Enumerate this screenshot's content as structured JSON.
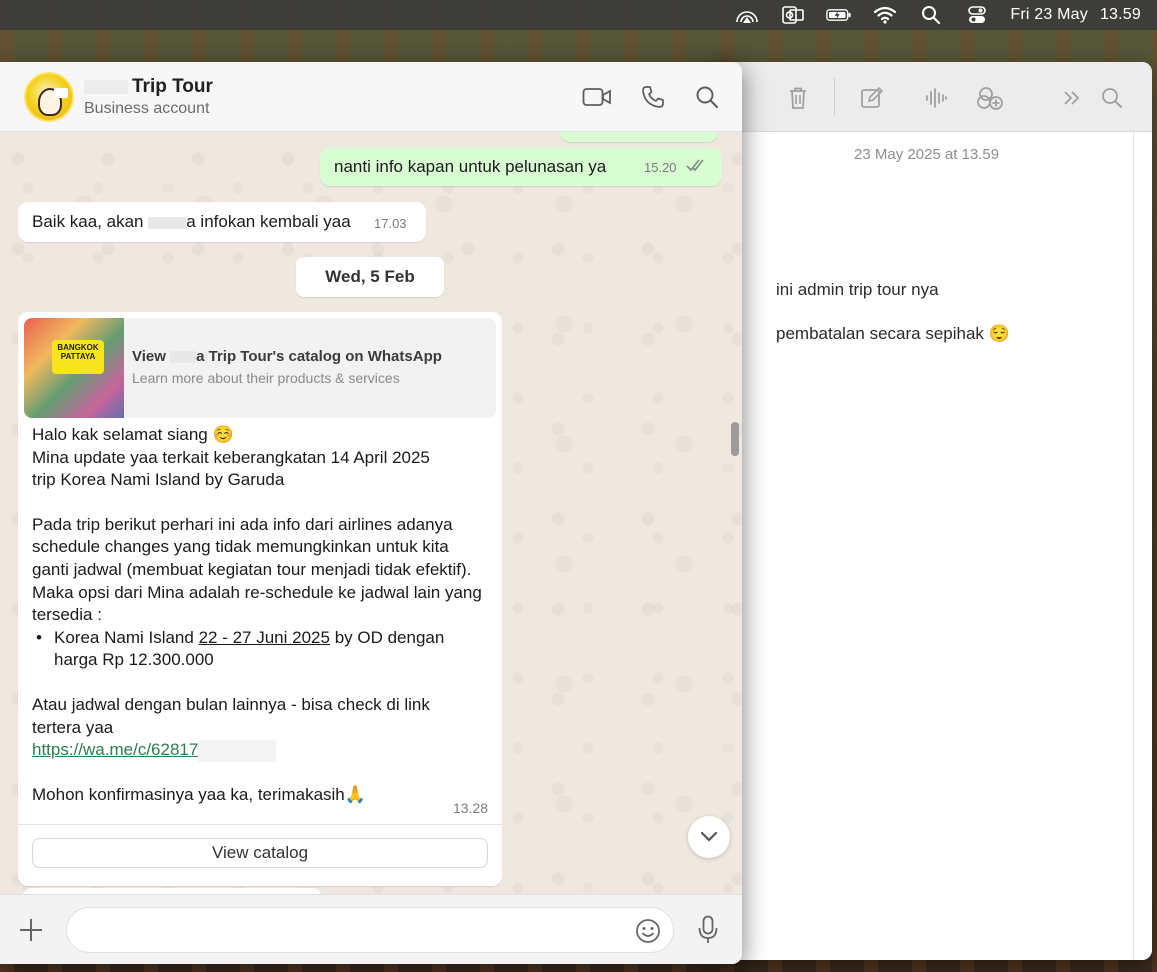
{
  "menubar": {
    "day": "Fri 23 May",
    "time": "13.59",
    "icons": [
      "airplay-icon",
      "outlook-icon",
      "battery-charging-icon",
      "wifi-icon",
      "spotlight-search-icon",
      "control-center-icon"
    ]
  },
  "notes": {
    "date": "23 May 2025 at 13.59",
    "line1": "ini admin trip tour nya",
    "line2": "pembatalan secara sepihak 😌",
    "toolbar_icons": [
      "trash-icon",
      "compose-icon",
      "audio-waveform-icon",
      "share-collab-icon",
      "chevron-double-right-icon",
      "search-icon"
    ]
  },
  "whatsapp": {
    "contact_name": "Trip Tour",
    "contact_subtitle": "Business account",
    "header_icons": [
      "video-call-icon",
      "voice-call-icon",
      "search-icon"
    ],
    "messages": {
      "out_1": {
        "text": "nanti info kapan untuk pelunasan ya",
        "time": "15.20"
      },
      "in_1": {
        "text_before": "Baik kaa, akan",
        "text_after": "a infokan kembali yaa",
        "time": "17.03"
      },
      "date_chip": "Wed, 5 Feb",
      "catalog": {
        "title_before": "View",
        "title_after": "a Trip Tour's catalog on WhatsApp",
        "subtitle": "Learn more about their products & services",
        "sticker_line1": "BANGKOK",
        "sticker_line2": "PATTAYA"
      },
      "big": {
        "p1": "Halo kak selamat siang ☺️",
        "p2": "Mina update yaa terkait keberangkatan 14 April 2025",
        "p3": "trip Korea Nami Island by Garuda",
        "p4": "Pada trip berikut perhari ini ada info dari airlines adanya schedule changes yang tidak memungkinkan untuk kita ganti jadwal (membuat kegiatan tour menjadi tidak efektif). Maka opsi dari Mina adalah re-schedule ke jadwal lain yang tersedia :",
        "bullet_before": "Korea Nami Island ",
        "bullet_date": "22 - 27 Juni 2025",
        "bullet_after": " by OD dengan harga Rp 12.300.000",
        "p5": "Atau jadwal dengan bulan lainnya - bisa check di link tertera yaa",
        "link": "https://wa.me/c/62817",
        "p6": "Mohon konfirmasinya yaa ka, terimakasih🙏",
        "time": "13.28",
        "button": "View catalog"
      }
    },
    "composer": {
      "placeholder": ""
    }
  }
}
